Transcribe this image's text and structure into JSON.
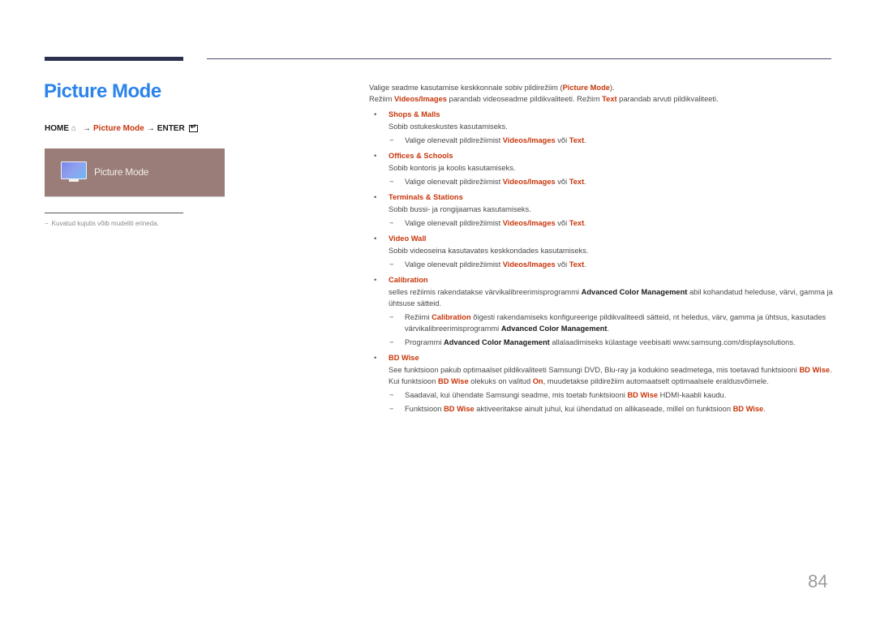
{
  "page": {
    "title": "Picture Mode",
    "page_number": "84",
    "colors": {
      "title_blue": "#2b84ea",
      "accent_red": "#c7360b",
      "header_bar": "#2c3150",
      "osd_background": "#9a7d78"
    }
  },
  "nav_path": {
    "home": "HOME",
    "home_icon": "home-icon",
    "arrow1": "→",
    "menu_item": "Picture Mode",
    "arrow2": "→",
    "enter": "ENTER",
    "enter_icon": "enter-icon"
  },
  "osd": {
    "icon": "monitor-icon",
    "label": "Picture Mode"
  },
  "side_note": {
    "dash": "−",
    "text": "Kuvatud kujutis võib mudeliti erineda."
  },
  "intro": {
    "p1_before": "Valige seadme kasutamise keskkonnale sobiv pildirežiim (",
    "p1_highlight": "Picture Mode",
    "p1_after": ").",
    "p2_a": "Režiim ",
    "p2_b": "Videos/Images",
    "p2_c": " parandab videoseadme pildikvaliteeti. Režiim ",
    "p2_d": "Text",
    "p2_e": " parandab arvuti pildikvaliteeti."
  },
  "modes": [
    {
      "title": "Shops & Malls",
      "desc": "Sobib ostukeskustes kasutamiseks.",
      "note_a": "Valige olenevalt pildirežiimist ",
      "note_b": "Videos/Images",
      "note_c": " või ",
      "note_d": "Text",
      "note_e": "."
    },
    {
      "title": "Offices & Schools",
      "desc": "Sobib kontoris ja koolis kasutamiseks.",
      "note_a": "Valige olenevalt pildirežiimist ",
      "note_b": "Videos/Images",
      "note_c": " või ",
      "note_d": "Text",
      "note_e": "."
    },
    {
      "title": "Terminals & Stations",
      "desc": "Sobib bussi- ja rongijaamas kasutamiseks.",
      "note_a": "Valige olenevalt pildirežiimist ",
      "note_b": "Videos/Images",
      "note_c": " või ",
      "note_d": "Text",
      "note_e": "."
    },
    {
      "title": "Video Wall",
      "desc": "Sobib videoseina kasutavates keskkondades kasutamiseks.",
      "note_a": "Valige olenevalt pildirežiimist ",
      "note_b": "Videos/Images",
      "note_c": " või ",
      "note_d": "Text",
      "note_e": "."
    }
  ],
  "calibration": {
    "title": "Calibration",
    "desc_a": "selles režiimis rakendatakse värvikalibreerimisprogrammi ",
    "desc_b": "Advanced Color Management",
    "desc_c": " abil kohandatud heleduse, värvi, gamma ja ühtsuse sätteid.",
    "note1_a": "Režiimi ",
    "note1_b": "Calibration",
    "note1_c": " õigesti rakendamiseks konfigureerige pildikvaliteedi sätteid, nt heledus, värv, gamma ja ühtsus, kasutades värvikalibreerimisprogrammi ",
    "note1_d": "Advanced Color Management",
    "note1_e": ".",
    "note2_a": "Programmi ",
    "note2_b": "Advanced Color Management",
    "note2_c": " allalaadimiseks külastage veebisaiti www.samsung.com/displaysolutions."
  },
  "bdwise": {
    "title": "BD Wise",
    "desc_a": "See funktsioon pakub optimaalset pildikvaliteeti Samsungi DVD, Blu-ray ja kodukino seadmetega, mis toetavad funktsiooni ",
    "desc_b": "BD Wise",
    "desc_c": ". Kui funktsioon ",
    "desc_d": "BD Wise",
    "desc_e": " olekuks on valitud ",
    "desc_f": "On",
    "desc_g": ", muudetakse pildirežiim automaatselt optimaalsele eraldusvõimele.",
    "note1_a": "Saadaval, kui ühendate Samsungi seadme, mis toetab funktsiooni ",
    "note1_b": "BD Wise",
    "note1_c": " HDMI-kaabli kaudu.",
    "note2_a": "Funktsioon ",
    "note2_b": "BD Wise",
    "note2_c": " aktiveeritakse ainult juhul, kui ühendatud on allikaseade, millel on funktsioon ",
    "note2_d": "BD Wise",
    "note2_e": "."
  },
  "markers": {
    "bullet": "•",
    "dash": "−"
  }
}
